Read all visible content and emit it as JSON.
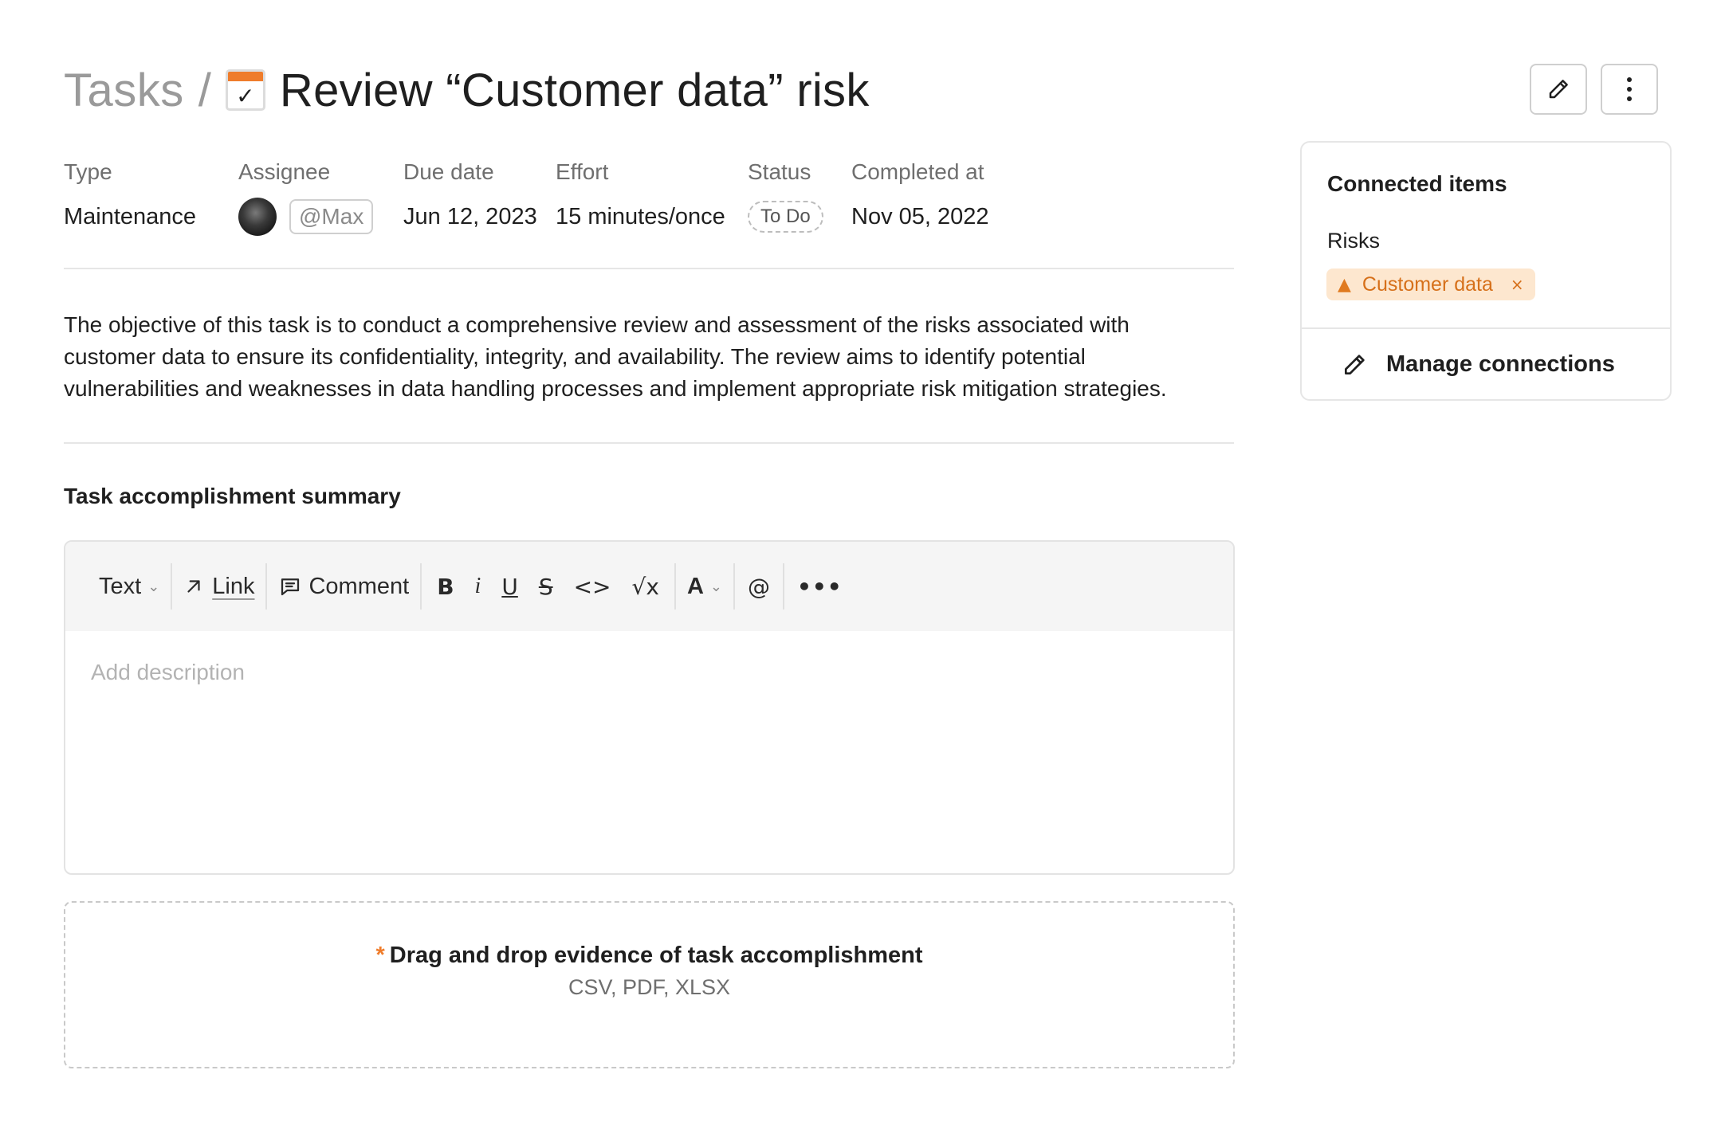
{
  "header": {
    "breadcrumb": "Tasks",
    "separator": "/",
    "title": "Review “Customer data” risk",
    "icon_check": "✓",
    "icons": {
      "task": "calendar-check-icon",
      "edit": "pencil-icon",
      "more": "kebab-menu-icon"
    }
  },
  "meta": {
    "type_label": "Type",
    "type_value": "Maintenance",
    "assignee_label": "Assignee",
    "assignee_mention": "@Max",
    "due_label": "Due date",
    "due_value": "Jun 12, 2023",
    "effort_label": "Effort",
    "effort_value": "15 minutes/once",
    "status_label": "Status",
    "status_value": "To Do",
    "completed_label": "Completed at",
    "completed_value": "Nov 05, 2022"
  },
  "description": {
    "line1": "The objective of this task is to conduct a comprehensive review and assessment of the risks associated with",
    "line2": "customer data to ensure its confidentiality, integrity, and availability. The review aims to identify potential",
    "line3": "vulnerabilities and weaknesses in data handling processes and implement appropriate risk mitigation strategies."
  },
  "summary": {
    "title": "Task accomplishment summary",
    "toolbar": {
      "text_label": "Text",
      "link_label": "Link",
      "comment_label": "Comment",
      "bold": "B",
      "italic": "i",
      "underline": "U",
      "strike": "S",
      "code": "<>",
      "math": "√x",
      "color": "A",
      "mention": "@",
      "more": "•••"
    },
    "placeholder": "Add description",
    "value": ""
  },
  "dropzone": {
    "required_mark": "*",
    "title": "Drag and drop evidence of task accomplishment",
    "formats": "CSV, PDF, XLSX"
  },
  "connected": {
    "title": "Connected items",
    "risks_label": "Risks",
    "risk_chip": "Customer data",
    "remove": "×",
    "warn_glyph": "▲",
    "manage_label": "Manage connections"
  },
  "colors": {
    "accent_orange": "#ef7c2b",
    "chip_bg": "#fde7cf",
    "chip_text": "#d6701a",
    "border": "#e6e6e6",
    "muted_text": "#6f6f6f"
  }
}
